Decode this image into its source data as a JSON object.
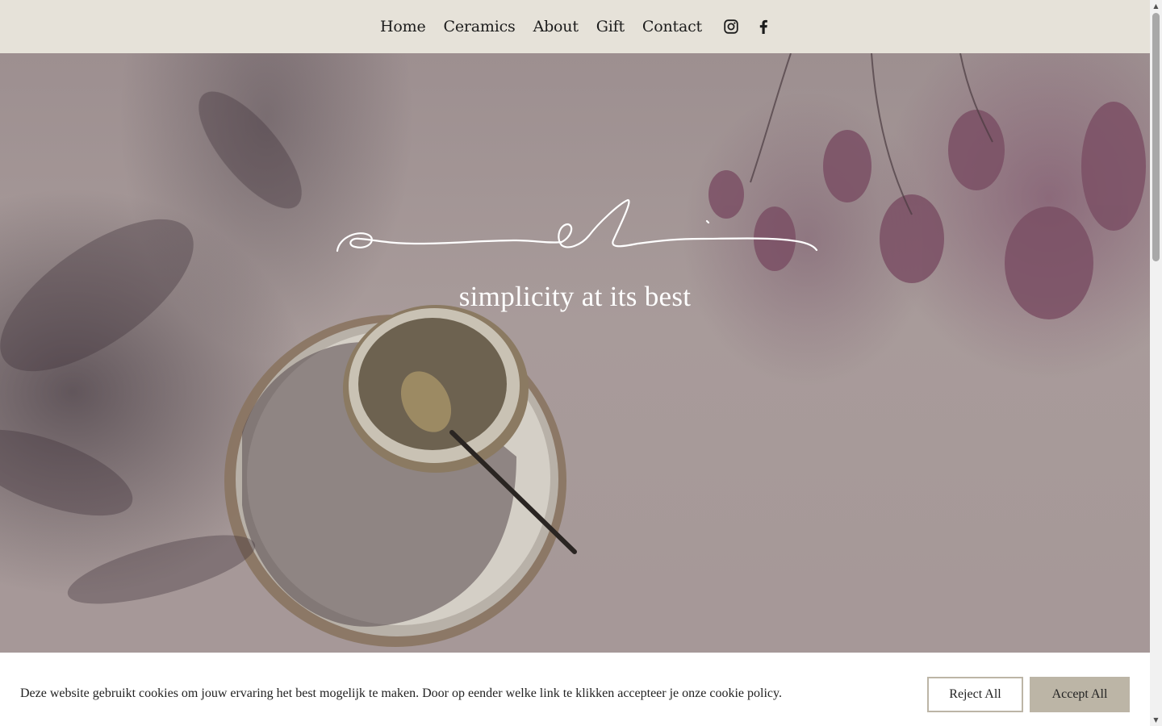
{
  "nav": {
    "links": [
      "Home",
      "Ceramics",
      "About",
      "Gift",
      "Contact"
    ],
    "social": [
      "instagram-icon",
      "facebook-icon"
    ]
  },
  "hero": {
    "logo_script": "ameli",
    "tagline": "simplicity at its best"
  },
  "cookie": {
    "text": "Deze website gebruikt cookies om jouw ervaring het best mogelijk te maken. Door op eender welke link te klikken accepteer je onze cookie policy.",
    "reject_label": "Reject All",
    "accept_label": "Accept All"
  },
  "colors": {
    "header_bg": "#e6e2d9",
    "accept_bg": "#bcb5a6",
    "reject_border": "#bcb5a6"
  }
}
